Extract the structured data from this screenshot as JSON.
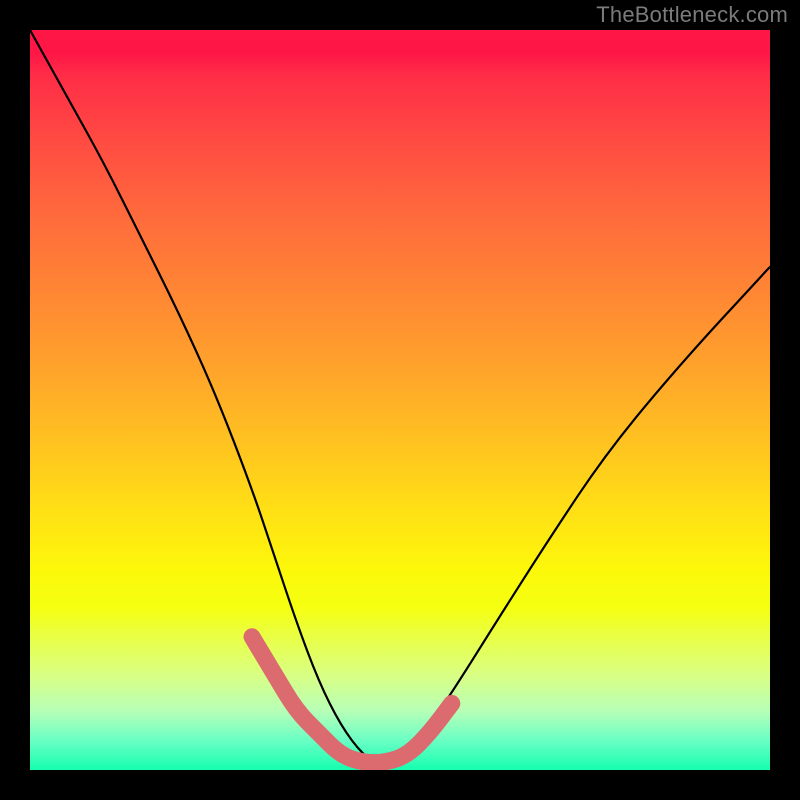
{
  "watermark": "TheBottleneck.com",
  "chart_data": {
    "type": "line",
    "title": "",
    "xlabel": "",
    "ylabel": "",
    "xlim": [
      0,
      100
    ],
    "ylim": [
      0,
      100
    ],
    "series": [
      {
        "name": "bottleneck-curve",
        "x": [
          0,
          5,
          10,
          15,
          20,
          25,
          30,
          33,
          36,
          39,
          42,
          45,
          48,
          51,
          54,
          58,
          63,
          70,
          78,
          88,
          100
        ],
        "values": [
          100,
          91,
          82,
          72,
          62,
          51,
          38,
          29,
          20,
          12,
          6,
          2,
          0,
          2,
          6,
          12,
          20,
          31,
          43,
          55,
          68
        ]
      }
    ],
    "markers": {
      "name": "highlight-band",
      "color": "#db6b6f",
      "x": [
        30,
        33,
        36,
        39,
        42,
        45,
        48,
        51,
        54,
        57
      ],
      "values": [
        18,
        13,
        8,
        5,
        2,
        1,
        1,
        2,
        5,
        9
      ]
    },
    "background_gradient": {
      "top": "#fe1646",
      "mid": "#ffdf15",
      "bottom": "#15ffaf"
    }
  }
}
